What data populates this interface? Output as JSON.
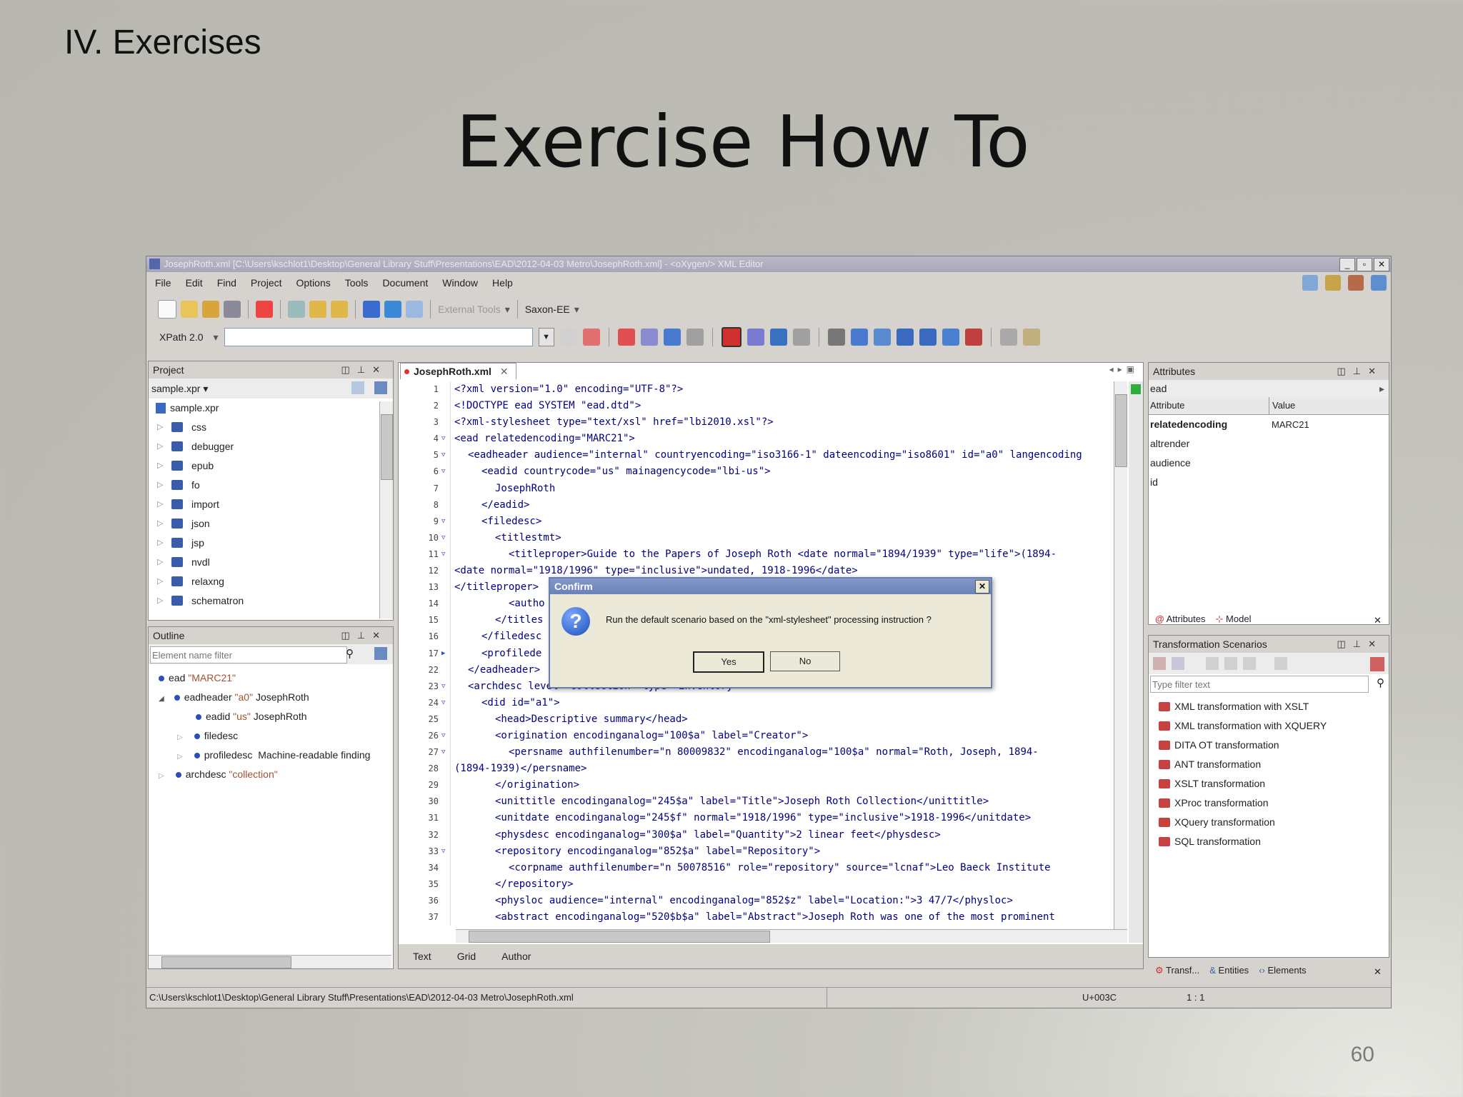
{
  "slide": {
    "section": "IV. Exercises",
    "title": "Exercise How To",
    "page_number": "60"
  },
  "app": {
    "window_title": "JosephRoth.xml [C:\\Users\\kschlot1\\Desktop\\General Library Stuff\\Presentations\\EAD\\2012-04-03 Metro\\JosephRoth.xml] - <oXygen/> XML Editor",
    "menu": [
      "File",
      "Edit",
      "Find",
      "Project",
      "Options",
      "Tools",
      "Document",
      "Window",
      "Help"
    ],
    "toolbar": {
      "external_tools": "External Tools",
      "transformer": "Saxon-EE",
      "xpath_version": "XPath 2.0"
    }
  },
  "project_panel": {
    "title": "Project",
    "selector": "sample.xpr",
    "items": [
      "sample.xpr",
      "css",
      "debugger",
      "epub",
      "fo",
      "import",
      "json",
      "jsp",
      "nvdl",
      "relaxng",
      "schematron"
    ]
  },
  "outline_panel": {
    "title": "Outline",
    "filter_placeholder": "Element name filter",
    "items": [
      {
        "name": "ead",
        "attr": "\"MARC21\"",
        "text": ""
      },
      {
        "name": "eadheader",
        "attr": "\"a0\"",
        "text": "JosephRoth"
      },
      {
        "name": "eadid",
        "attr": "\"us\"",
        "text": "JosephRoth"
      },
      {
        "name": "filedesc",
        "attr": "",
        "text": ""
      },
      {
        "name": "profiledesc",
        "attr": "",
        "text": "Machine-readable finding"
      },
      {
        "name": "archdesc",
        "attr": "\"collection\"",
        "text": ""
      }
    ]
  },
  "editor": {
    "tab": "JosephRoth.xml",
    "modes": [
      "Text",
      "Grid",
      "Author"
    ],
    "lines": [
      {
        "n": "1",
        "f": "",
        "i": 0,
        "t": "<?xml version=\"1.0\" encoding=\"UTF-8\"?>"
      },
      {
        "n": "2",
        "f": "",
        "i": 0,
        "t": "<!DOCTYPE ead SYSTEM \"ead.dtd\">"
      },
      {
        "n": "3",
        "f": "",
        "i": 0,
        "t": "<?xml-stylesheet type=\"text/xsl\" href=\"lbi2010.xsl\"?>"
      },
      {
        "n": "4",
        "f": "▽",
        "i": 0,
        "t": "<ead relatedencoding=\"MARC21\">"
      },
      {
        "n": "5",
        "f": "▽",
        "i": 1,
        "t": "<eadheader audience=\"internal\" countryencoding=\"iso3166-1\" dateencoding=\"iso8601\" id=\"a0\" langencoding"
      },
      {
        "n": "6",
        "f": "▽",
        "i": 2,
        "t": "<eadid countrycode=\"us\" mainagencycode=\"lbi-us\">"
      },
      {
        "n": "7",
        "f": "",
        "i": 3,
        "t": "JosephRoth"
      },
      {
        "n": "8",
        "f": "",
        "i": 2,
        "t": "</eadid>"
      },
      {
        "n": "9",
        "f": "▽",
        "i": 2,
        "t": "<filedesc>"
      },
      {
        "n": "10",
        "f": "▽",
        "i": 3,
        "t": "<titlestmt>"
      },
      {
        "n": "11",
        "f": "▽",
        "i": 4,
        "t": "<titleproper>Guide to the Papers of Joseph Roth <date normal=\"1894/1939\" type=\"life\">(1894-"
      },
      {
        "n": "12",
        "f": "",
        "i": 0,
        "t": "<date normal=\"1918/1996\" type=\"inclusive\">undated, 1918-1996</date>"
      },
      {
        "n": "13",
        "f": "",
        "i": 0,
        "t": "</titleproper>"
      },
      {
        "n": "14",
        "f": "",
        "i": 4,
        "t": "<autho"
      },
      {
        "n": "15",
        "f": "",
        "i": 3,
        "t": "</titles"
      },
      {
        "n": "16",
        "f": "",
        "i": 2,
        "t": "</filedesc"
      },
      {
        "n": "17",
        "f": "▶",
        "i": 2,
        "t": "<profilede"
      },
      {
        "n": "22",
        "f": "",
        "i": 1,
        "t": "</eadheader>"
      },
      {
        "n": "23",
        "f": "▽",
        "i": 1,
        "t": "<archdesc level=\"collection\" type=\"inventory\">"
      },
      {
        "n": "24",
        "f": "▽",
        "i": 2,
        "t": "<did id=\"a1\">"
      },
      {
        "n": "25",
        "f": "",
        "i": 3,
        "t": "<head>Descriptive summary</head>"
      },
      {
        "n": "26",
        "f": "▽",
        "i": 3,
        "t": "<origination encodinganalog=\"100$a\" label=\"Creator\">"
      },
      {
        "n": "27",
        "f": "▽",
        "i": 4,
        "t": "<persname authfilenumber=\"n 80009832\" encodinganalog=\"100$a\" normal=\"Roth, Joseph, 1894-"
      },
      {
        "n": "28",
        "f": "",
        "i": 0,
        "t": "(1894-1939)</persname>"
      },
      {
        "n": "29",
        "f": "",
        "i": 3,
        "t": "</origination>"
      },
      {
        "n": "30",
        "f": "",
        "i": 3,
        "t": "<unittitle encodinganalog=\"245$a\" label=\"Title\">Joseph Roth Collection</unittitle>"
      },
      {
        "n": "31",
        "f": "",
        "i": 3,
        "t": "<unitdate encodinganalog=\"245$f\" normal=\"1918/1996\" type=\"inclusive\">1918-1996</unitdate>"
      },
      {
        "n": "32",
        "f": "",
        "i": 3,
        "t": "<physdesc encodinganalog=\"300$a\" label=\"Quantity\">2 linear feet</physdesc>"
      },
      {
        "n": "33",
        "f": "▽",
        "i": 3,
        "t": "<repository encodinganalog=\"852$a\" label=\"Repository\">"
      },
      {
        "n": "34",
        "f": "",
        "i": 4,
        "t": "<corpname authfilenumber=\"n 50078516\" role=\"repository\" source=\"lcnaf\">Leo Baeck Institute"
      },
      {
        "n": "35",
        "f": "",
        "i": 3,
        "t": "</repository>"
      },
      {
        "n": "36",
        "f": "",
        "i": 3,
        "t": "<physloc audience=\"internal\" encodinganalog=\"852$z\" label=\"Location:\">3 47/7</physloc>"
      },
      {
        "n": "37",
        "f": "",
        "i": 3,
        "t": "<abstract encodinganalog=\"520$b$a\" label=\"Abstract\">Joseph Roth was one of the most prominent"
      }
    ]
  },
  "dialog": {
    "title": "Confirm",
    "message": "Run the default scenario based on the \"xml-stylesheet\" processing instruction ?",
    "yes": "Yes",
    "no": "No"
  },
  "attributes_panel": {
    "title": "Attributes",
    "element": "ead",
    "col_attribute": "Attribute",
    "col_value": "Value",
    "rows": [
      {
        "name": "relatedencoding",
        "value": "MARC21"
      },
      {
        "name": "altrender",
        "value": ""
      },
      {
        "name": "audience",
        "value": ""
      },
      {
        "name": "id",
        "value": ""
      }
    ],
    "tabs": [
      "Attributes",
      "Model"
    ]
  },
  "scenarios_panel": {
    "title": "Transformation Scenarios",
    "filter_placeholder": "Type filter text",
    "items": [
      "XML transformation with XSLT",
      "XML transformation with XQUERY",
      "DITA OT transformation",
      "ANT transformation",
      "XSLT transformation",
      "XProc transformation",
      "XQuery transformation",
      "SQL transformation"
    ],
    "tabs": [
      "Transf...",
      "Entities",
      "Elements"
    ]
  },
  "status": {
    "path": "C:\\Users\\kschlot1\\Desktop\\General Library Stuff\\Presentations\\EAD\\2012-04-03 Metro\\JosephRoth.xml",
    "unicode": "U+003C",
    "position": "1 : 1"
  }
}
